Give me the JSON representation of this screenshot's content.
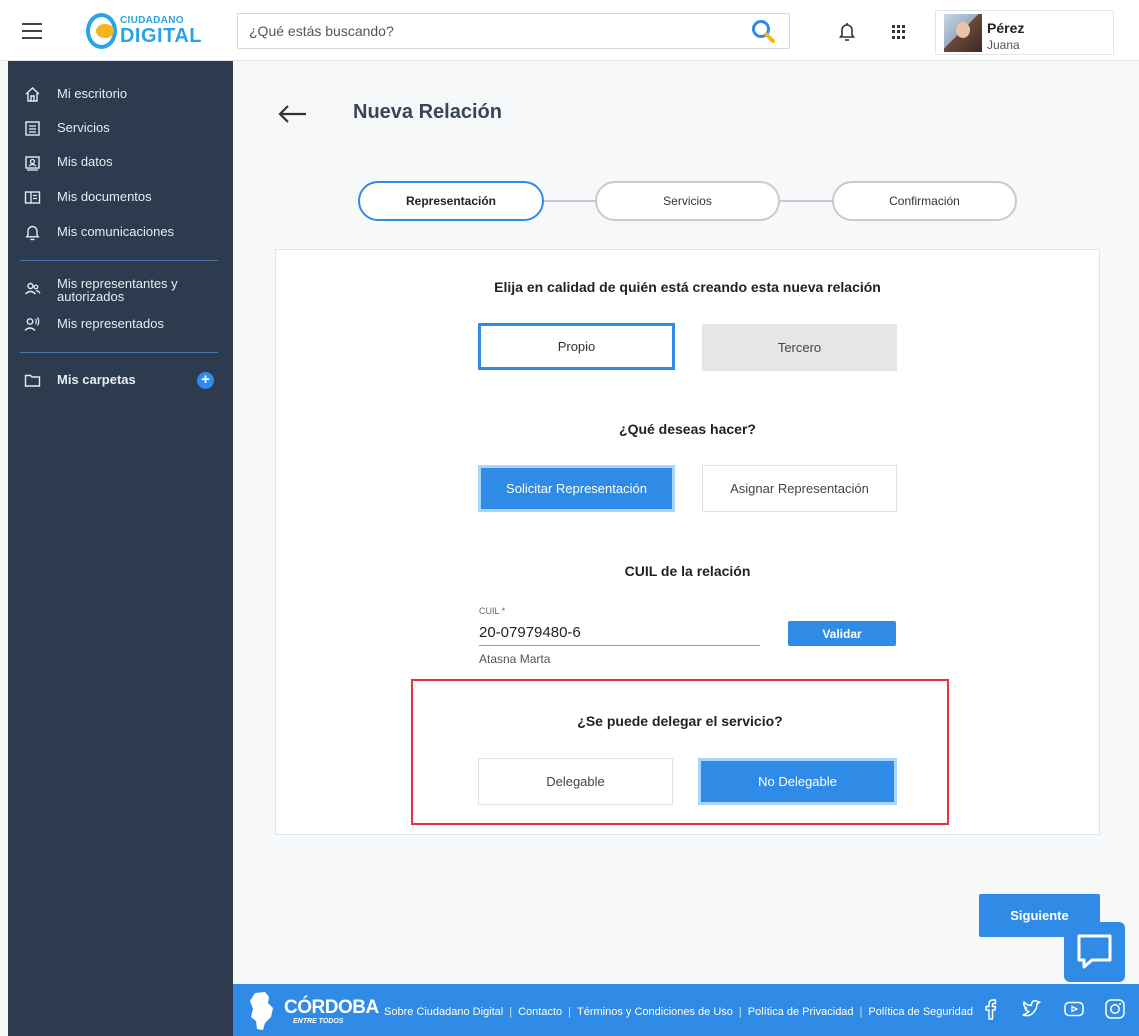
{
  "header": {
    "logo_top": "CIUDADANO",
    "logo_main": "DIGITAL",
    "search_placeholder": "¿Qué estás buscando?",
    "user_last_name": "Pérez",
    "user_first_name": "Juana"
  },
  "sidebar": {
    "items": [
      {
        "label": "Mi escritorio",
        "icon": "home-icon"
      },
      {
        "label": "Servicios",
        "icon": "list-icon"
      },
      {
        "label": "Mis datos",
        "icon": "id-card-icon"
      },
      {
        "label": "Mis documentos",
        "icon": "document-icon"
      },
      {
        "label": "Mis comunicaciones",
        "icon": "bell-icon"
      },
      {
        "label": "Mis representantes y autorizados",
        "icon": "people-icon"
      },
      {
        "label": "Mis representados",
        "icon": "person-voice-icon"
      },
      {
        "label": "Mis carpetas",
        "icon": "folder-icon"
      }
    ]
  },
  "main": {
    "title": "Nueva Relación",
    "steps": [
      "Representación",
      "Servicios",
      "Confirmación"
    ],
    "active_step": "Representación",
    "q1": {
      "title": "Elija en calidad de quién está creando esta nueva relación",
      "options": [
        "Propio",
        "Tercero"
      ],
      "selected": "Propio"
    },
    "q2": {
      "title": "¿Qué deseas hacer?",
      "options": [
        "Solicitar Representación",
        "Asignar Representación"
      ],
      "selected": "Solicitar Representación"
    },
    "cuil": {
      "title": "CUIL de la relación",
      "caption": "CUIL *",
      "value": "20-07979480-6",
      "name": "Atasna Marta",
      "validate_label": "Validar"
    },
    "q3": {
      "title": "¿Se puede delegar el servicio?",
      "options": [
        "Delegable",
        "No Delegable"
      ],
      "selected": "No Delegable"
    },
    "next_label": "Siguiente"
  },
  "footer": {
    "brand": "CÓRDOBA",
    "brand_sub": "ENTRE TODOS",
    "links": [
      "Sobre Ciudadano Digital",
      "Contacto",
      "Términos y Condiciones de Uso",
      "Política de Privacidad",
      "Política de Seguridad"
    ],
    "social": [
      "facebook-icon",
      "twitter-icon",
      "youtube-icon",
      "instagram-icon"
    ]
  },
  "colors": {
    "accent": "#2f8be6",
    "sidebar": "#2e3a4d",
    "highlight": "#e53238"
  }
}
